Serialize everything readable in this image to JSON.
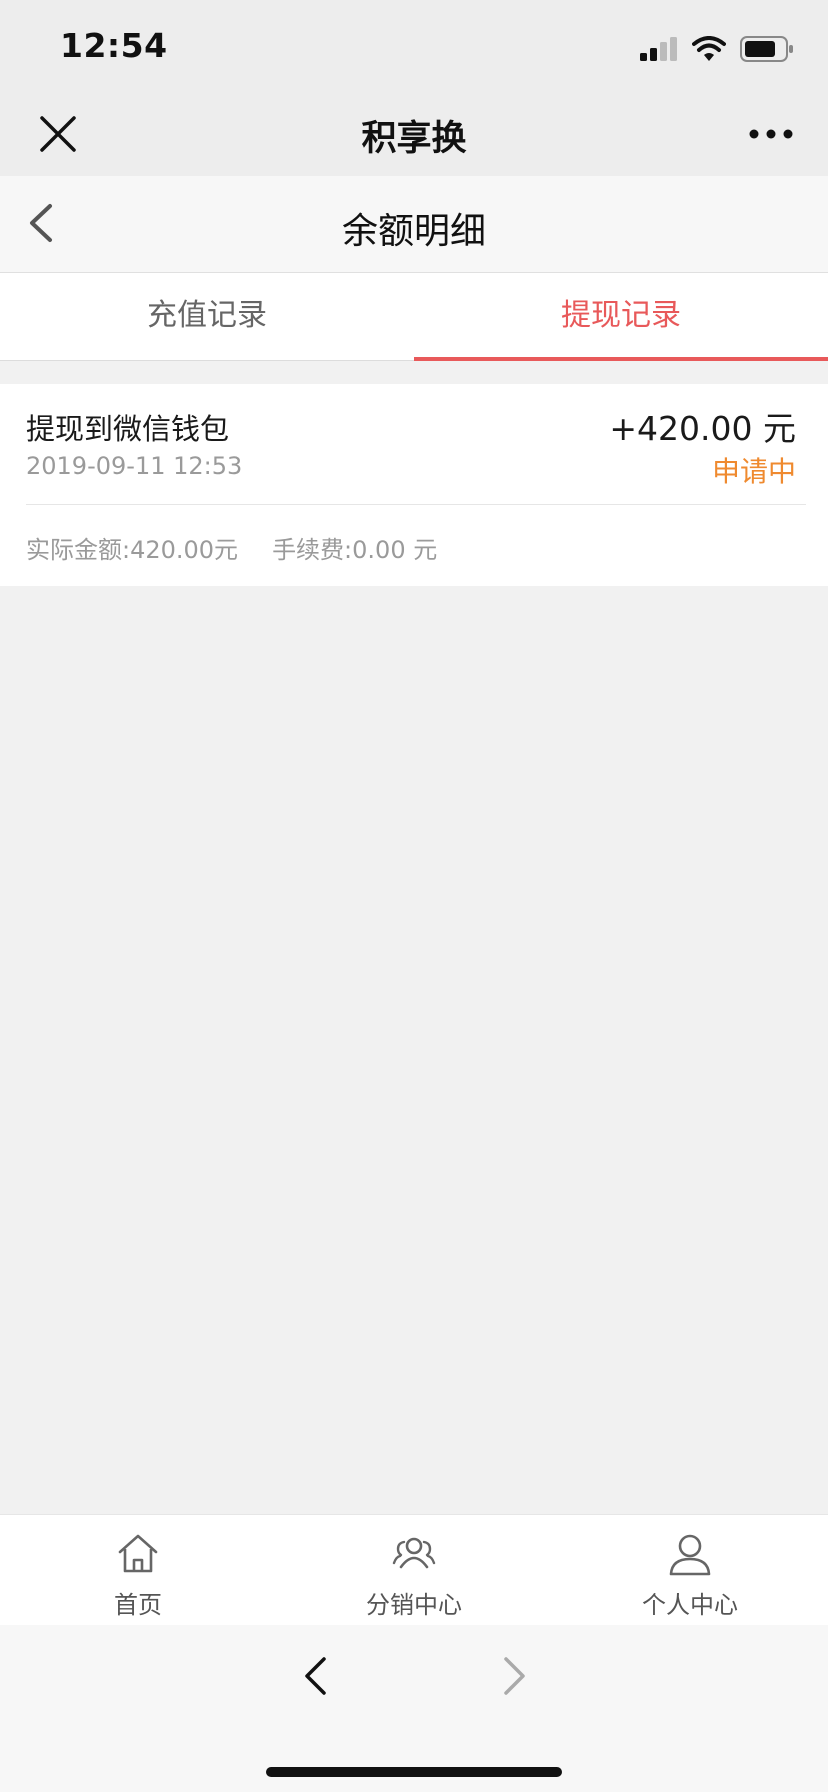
{
  "status_bar": {
    "time": "12:54",
    "icons": [
      "signal-icon",
      "wifi-icon",
      "battery-icon"
    ]
  },
  "app_bar": {
    "title": "积享换",
    "close_icon": "close-icon",
    "more_icon": "more-dots-icon"
  },
  "page_header": {
    "title": "余额明细",
    "back_icon": "chevron-left-icon"
  },
  "tabs": {
    "items": [
      {
        "label": "充值记录",
        "active": false
      },
      {
        "label": "提现记录",
        "active": true
      }
    ],
    "active_color": "#e8595a"
  },
  "records": [
    {
      "title": "提现到微信钱包",
      "time": "2019-09-11 12:53",
      "amount": "+420.00 元",
      "status": "申请中",
      "status_color": "#ef8a2f",
      "actual_amount": "实际金额:420.00元",
      "fee": "手续费:0.00 元"
    }
  ],
  "bottom_nav": {
    "items": [
      {
        "label": "首页",
        "icon": "home-icon"
      },
      {
        "label": "分销中心",
        "icon": "users-icon"
      },
      {
        "label": "个人中心",
        "icon": "user-icon"
      }
    ]
  },
  "browser_bar": {
    "back_icon": "browser-back-icon",
    "forward_icon": "browser-forward-icon"
  }
}
